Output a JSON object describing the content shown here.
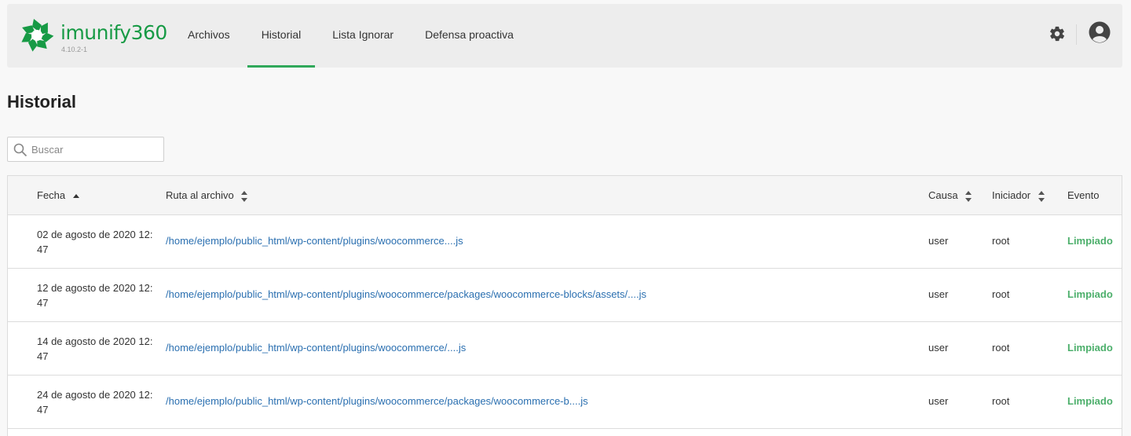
{
  "app": {
    "logo_text": "imunify360",
    "version": "4.10.2-1",
    "brand_color": "#179a45",
    "accent_color": "#30a85a"
  },
  "nav": {
    "items": [
      {
        "label": "Archivos",
        "active": false
      },
      {
        "label": "Historial",
        "active": true
      },
      {
        "label": "Lista Ignorar",
        "active": false
      },
      {
        "label": "Defensa proactiva",
        "active": false
      }
    ],
    "settings_icon": "gear-icon",
    "user_icon": "user-avatar-icon"
  },
  "page": {
    "title": "Historial"
  },
  "search": {
    "placeholder": "Buscar",
    "value": ""
  },
  "table": {
    "columns": [
      {
        "label": "Fecha",
        "sort": "asc"
      },
      {
        "label": "Ruta al archivo",
        "sort": "both"
      },
      {
        "label": "Causa",
        "sort": "both"
      },
      {
        "label": "Iniciador",
        "sort": "both"
      },
      {
        "label": "Evento",
        "sort": "none"
      }
    ],
    "rows": [
      {
        "date": "02 de agosto de 2020 12:47",
        "path": "/home/ejemplo/public_html/wp-content/plugins/woocommerce....js",
        "cause": "user",
        "initiator": "root",
        "event": "Limpiado"
      },
      {
        "date": "12 de agosto de 2020 12:47",
        "path": "/home/ejemplo/public_html/wp-content/plugins/woocommerce/packages/woocommerce-blocks/assets/....js",
        "cause": "user",
        "initiator": "root",
        "event": "Limpiado"
      },
      {
        "date": "14 de agosto de 2020 12:47",
        "path": "/home/ejemplo/public_html/wp-content/plugins/woocommerce/....js",
        "cause": "user",
        "initiator": "root",
        "event": "Limpiado"
      },
      {
        "date": "24 de agosto de 2020 12:47",
        "path": "/home/ejemplo/public_html/wp-content/plugins/woocommerce/packages/woocommerce-b....js",
        "cause": "user",
        "initiator": "root",
        "event": "Limpiado"
      }
    ]
  }
}
